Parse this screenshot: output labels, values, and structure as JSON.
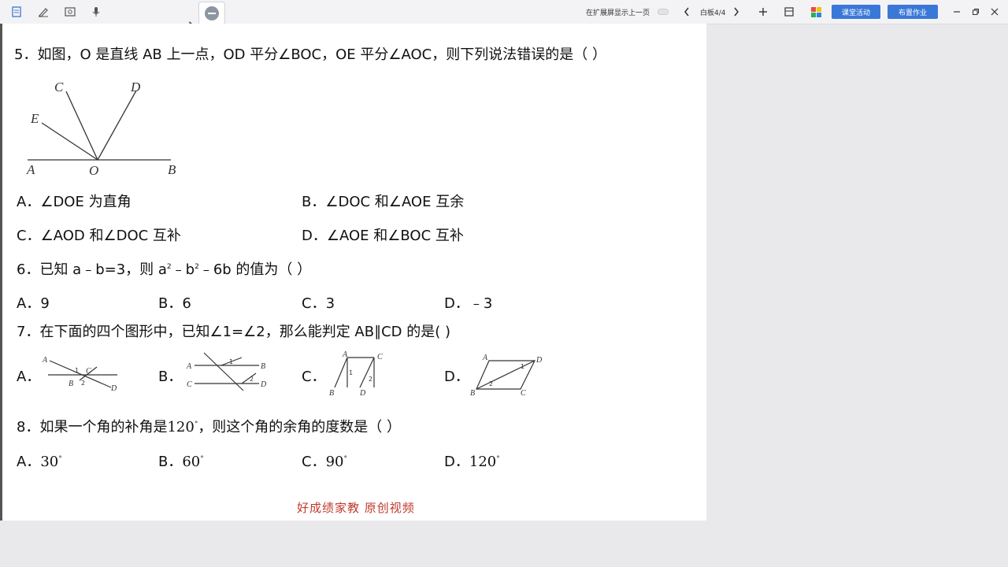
{
  "toolbar": {
    "icons": [
      "page-icon",
      "pen-icon",
      "capture-icon",
      "mic-icon"
    ],
    "minimize_label": "",
    "hint": "在扩展屏显示上一页",
    "page_indicator": "白板4/4",
    "btn1": "课堂活动",
    "btn2": "布置作业"
  },
  "q5": {
    "text": "5．如图，O 是直线 AB 上一点，OD 平分∠BOC，OE 平分∠AOC，则下列说法错误的是（    ）",
    "labels": {
      "A": "A",
      "O": "O",
      "B": "B",
      "C": "C",
      "D": "D",
      "E": "E"
    },
    "optA": "A．∠DOE 为直角",
    "optB": "B．∠DOC 和∠AOE 互余",
    "optC": "C．∠AOD 和∠DOC 互补",
    "optD": "D．∠AOE 和∠BOC 互补"
  },
  "q6": {
    "prefix": "6．已知 a﹣b=3，则 a",
    "sup1": "2",
    "mid": "﹣b",
    "sup2": "2",
    "suffix": "﹣6b 的值为（    ）",
    "optA": "A．9",
    "optB": "B．6",
    "optC": "C．3",
    "optD": "D．﹣3"
  },
  "q7": {
    "text": "7．在下面的四个图形中，已知∠1=∠2，那么能判定 AB∥CD 的是(      )",
    "optA": "A．",
    "optB": "B．",
    "optC": "C．",
    "optD": "D．",
    "figA": {
      "A": "A",
      "B": "B",
      "C": "C",
      "D": "D",
      "n1": "1",
      "n2": "2"
    },
    "figB": {
      "A": "A",
      "B": "B",
      "C": "C",
      "D": "D",
      "n1": "1",
      "n2": "2"
    },
    "figC": {
      "A": "A",
      "B": "B",
      "C": "C",
      "D": "D",
      "n1": "1",
      "n2": "2"
    },
    "figD": {
      "A": "A",
      "B": "B",
      "C": "C",
      "D": "D",
      "n1": "1",
      "n2": "2"
    }
  },
  "q8": {
    "prefix": "8．如果一个角的补角是",
    "angle": "120",
    "deg": "°",
    "suffix": "，则这个角的余角的度数是（    ）",
    "optA_label": "A．",
    "optA_val": "30",
    "optA_deg": "°",
    "optB_label": "B．",
    "optB_val": "60",
    "optB_deg": "°",
    "optC_label": "C．",
    "optC_val": "90",
    "optC_deg": "°",
    "optD_label": "D．",
    "optD_val": "120",
    "optD_deg": "°"
  },
  "footer": "好成绩家教    原创视频"
}
